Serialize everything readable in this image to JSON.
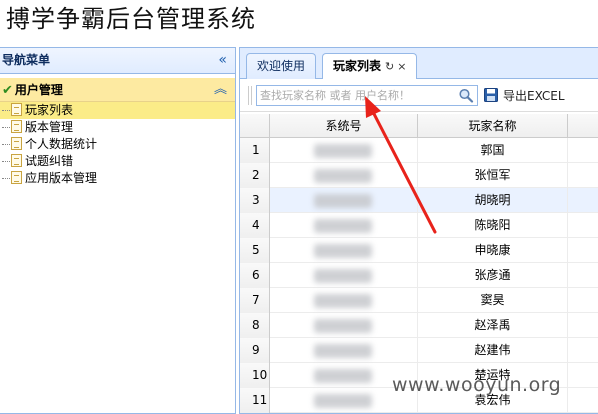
{
  "page_title": "搏学争霸后台管理系统",
  "sidebar": {
    "title": "导航菜单",
    "collapse_glyph": "«",
    "group": {
      "label": "用户管理",
      "collapse_glyph": "︽"
    },
    "items": [
      {
        "label": "玩家列表",
        "active": true
      },
      {
        "label": "版本管理",
        "active": false
      },
      {
        "label": "个人数据统计",
        "active": false
      },
      {
        "label": "试题纠错",
        "active": false
      },
      {
        "label": "应用版本管理",
        "active": false
      }
    ]
  },
  "tabs": [
    {
      "label": "欢迎使用"
    },
    {
      "label": "玩家列表",
      "refresh_glyph": "↻",
      "close_glyph": "×"
    }
  ],
  "toolbar": {
    "search_placeholder": "查找玩家名称 或者 用户名称！",
    "export_label": "导出EXCEL"
  },
  "grid": {
    "columns": [
      "系统号",
      "玩家名称"
    ],
    "rows": [
      {
        "num": "1",
        "name": "郭国"
      },
      {
        "num": "2",
        "name": "张恒军"
      },
      {
        "num": "3",
        "name": "胡晓明"
      },
      {
        "num": "4",
        "name": "陈晓阳"
      },
      {
        "num": "5",
        "name": "申晓康"
      },
      {
        "num": "6",
        "name": "张彦通"
      },
      {
        "num": "7",
        "name": "窦昊"
      },
      {
        "num": "8",
        "name": "赵泽禹"
      },
      {
        "num": "9",
        "name": "赵建伟"
      },
      {
        "num": "10",
        "name": "楚运特"
      },
      {
        "num": "11",
        "name": "袁宏伟"
      }
    ],
    "highlighted_row": 3
  },
  "watermark": "www.wooyun.org",
  "colors": {
    "border": "#95b8e7",
    "active_item": "#fbec88",
    "arrow": "#e8231b"
  }
}
